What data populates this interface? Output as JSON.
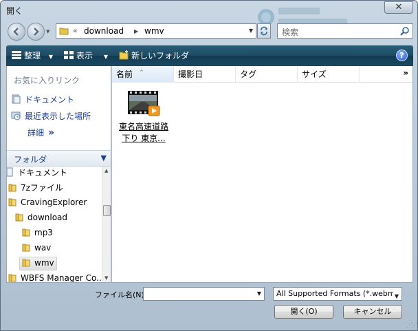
{
  "window": {
    "title": "開く",
    "close_label": "✕"
  },
  "address": {
    "overflow": "«",
    "segments": [
      "download",
      "wmv"
    ]
  },
  "search": {
    "placeholder": "検索"
  },
  "toolbar": {
    "organize": "整理",
    "view": "表示",
    "new_folder": "新しいフォルダ",
    "help": "?"
  },
  "favorites": {
    "header": "お気に入りリンク",
    "links": [
      "ドキュメント",
      "最近表示した場所"
    ],
    "more": "詳細",
    "more_glyph": "»"
  },
  "folders": {
    "header": "フォルダ",
    "tree": [
      "ドキュメント",
      "7zファイル",
      "CravingExplorer",
      "download",
      "mp3",
      "wav",
      "wmv",
      "WBFS Manager Co..."
    ],
    "selected": "wmv"
  },
  "columns": {
    "name": "名前",
    "date": "撮影日",
    "tag": "タグ",
    "size": "サイズ",
    "more": "»"
  },
  "files": [
    {
      "name_line1": "東名高速道路",
      "name_line2": "下り 東京..."
    }
  ],
  "bottom": {
    "filename_label": "ファイル名(N):",
    "filename_value": "",
    "filetype_value": "All Supported Formats (*.webm;",
    "open_button": "開く(O)",
    "cancel_button": "キャンセル"
  },
  "colors": {
    "toolbar": "#1d4b63",
    "link": "#1e3f8a",
    "frame": "#bccbda"
  }
}
